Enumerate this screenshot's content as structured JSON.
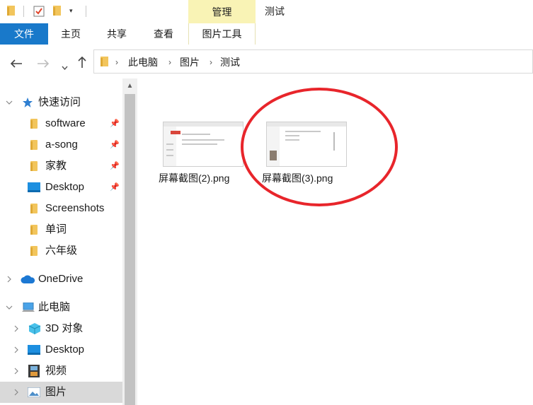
{
  "titlebar": {
    "contextual_tab": "管理",
    "window_title": "测试"
  },
  "ribbon": {
    "tabs": [
      "文件",
      "主页",
      "共享",
      "查看",
      "图片工具"
    ]
  },
  "address": {
    "crumbs": [
      "此电脑",
      "图片",
      "测试"
    ]
  },
  "nav": {
    "quick_access": "快速访问",
    "pinned": [
      "software",
      "a-song",
      "家教",
      "Desktop"
    ],
    "folders": [
      "Screenshots",
      "单词",
      "六年级"
    ],
    "onedrive": "OneDrive",
    "this_pc": "此电脑",
    "pc_items": [
      "3D 对象",
      "Desktop",
      "视频",
      "图片"
    ]
  },
  "files": [
    {
      "name": "屏幕截图(2).png"
    },
    {
      "name": "屏幕截图(3).png"
    }
  ],
  "colors": {
    "accent": "#1979ca",
    "context_tab": "#f9f3b5",
    "highlight_circle": "#e8252b",
    "selected_nav": "#d9d9d9"
  }
}
